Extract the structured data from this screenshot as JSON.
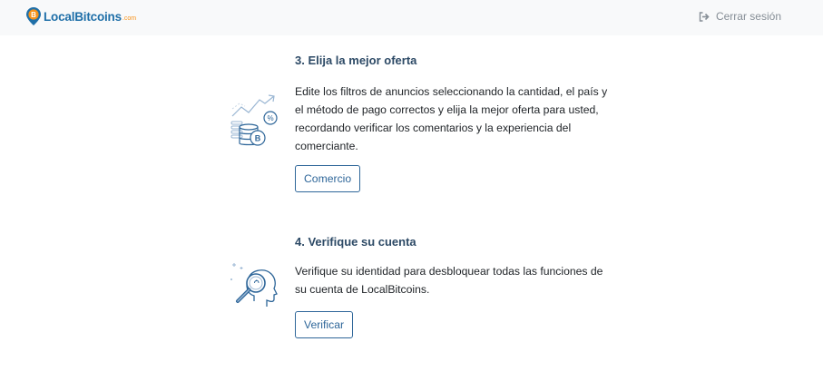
{
  "header": {
    "logo_text": "LocalBitcoins",
    "logo_suffix": ".com",
    "logout_label": "Cerrar sesión"
  },
  "steps": [
    {
      "title": "3. Elija la mejor oferta",
      "text": "Edite los filtros de anuncios seleccionando la cantidad, el país y el método de pago correctos y elija la mejor oferta para usted, recordando verificar los comentarios y la experiencia del comerciante.",
      "button_label": "Comercio",
      "icon": "coins-chart-icon"
    },
    {
      "title": "4. Verifique su cuenta",
      "text": "Verifique su identidad para desbloquear todas las funciones de su cuenta de LocalBitcoins.",
      "button_label": "Verificar",
      "icon": "identity-magnifier-icon"
    }
  ],
  "colors": {
    "accent": "#2e6699",
    "brand_orange": "#f7931a",
    "title": "#2d4a66",
    "header_bg": "#f8f9fa"
  }
}
